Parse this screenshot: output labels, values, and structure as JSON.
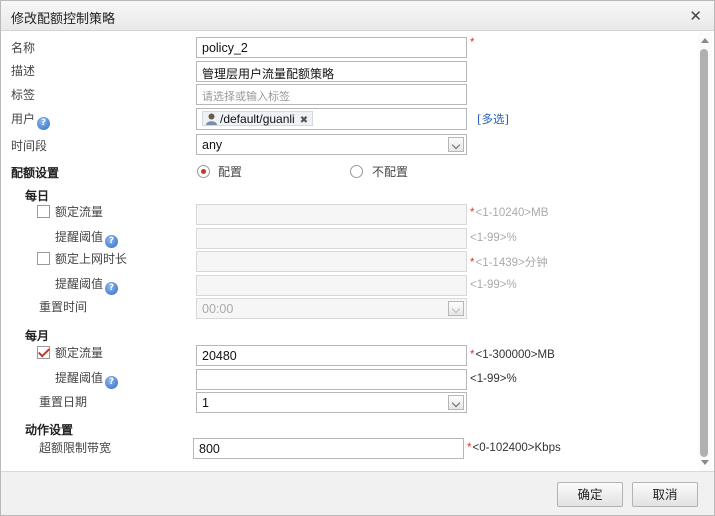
{
  "dialog": {
    "title": "修改配额控制策略"
  },
  "form": {
    "name": {
      "label": "名称",
      "value": "policy_2"
    },
    "description": {
      "label": "描述",
      "value": "管理层用户流量配额策略"
    },
    "tags": {
      "label": "标签",
      "placeholder": "请选择或输入标签"
    },
    "user": {
      "label": "用户",
      "tag": "/default/guanli",
      "multi_select": "[多选]"
    },
    "time_period": {
      "label": "时间段",
      "value": "any"
    },
    "quota_settings": {
      "label": "配额设置",
      "option_config": "配置",
      "option_noconfig": "不配置",
      "selected": "配置"
    },
    "daily": {
      "label": "每日",
      "traffic": {
        "label": "额定流量",
        "checked": false,
        "hint": "<1-10240>MB"
      },
      "traffic_threshold": {
        "label": "提醒阈值",
        "hint": "<1-99>%"
      },
      "online_time": {
        "label": "额定上网时长",
        "checked": false,
        "hint": "<1-1439>分钟"
      },
      "time_threshold": {
        "label": "提醒阈值",
        "hint": "<1-99>%"
      },
      "reset_time": {
        "label": "重置时间",
        "value": "00:00"
      }
    },
    "monthly": {
      "label": "每月",
      "traffic": {
        "label": "额定流量",
        "checked": true,
        "value": "20480",
        "hint": "<1-300000>MB"
      },
      "threshold": {
        "label": "提醒阈值",
        "hint": "<1-99>%"
      },
      "reset_date": {
        "label": "重置日期",
        "value": "1"
      }
    },
    "action": {
      "label": "动作设置",
      "bandwidth": {
        "label": "超额限制带宽",
        "value": "800",
        "hint": "<0-102400>Kbps"
      }
    }
  },
  "footer": {
    "ok_label": "确定",
    "cancel_label": "取消"
  },
  "colors": {
    "required": "#e03030",
    "checked": "#c0392b",
    "link": "#2a62b8"
  }
}
